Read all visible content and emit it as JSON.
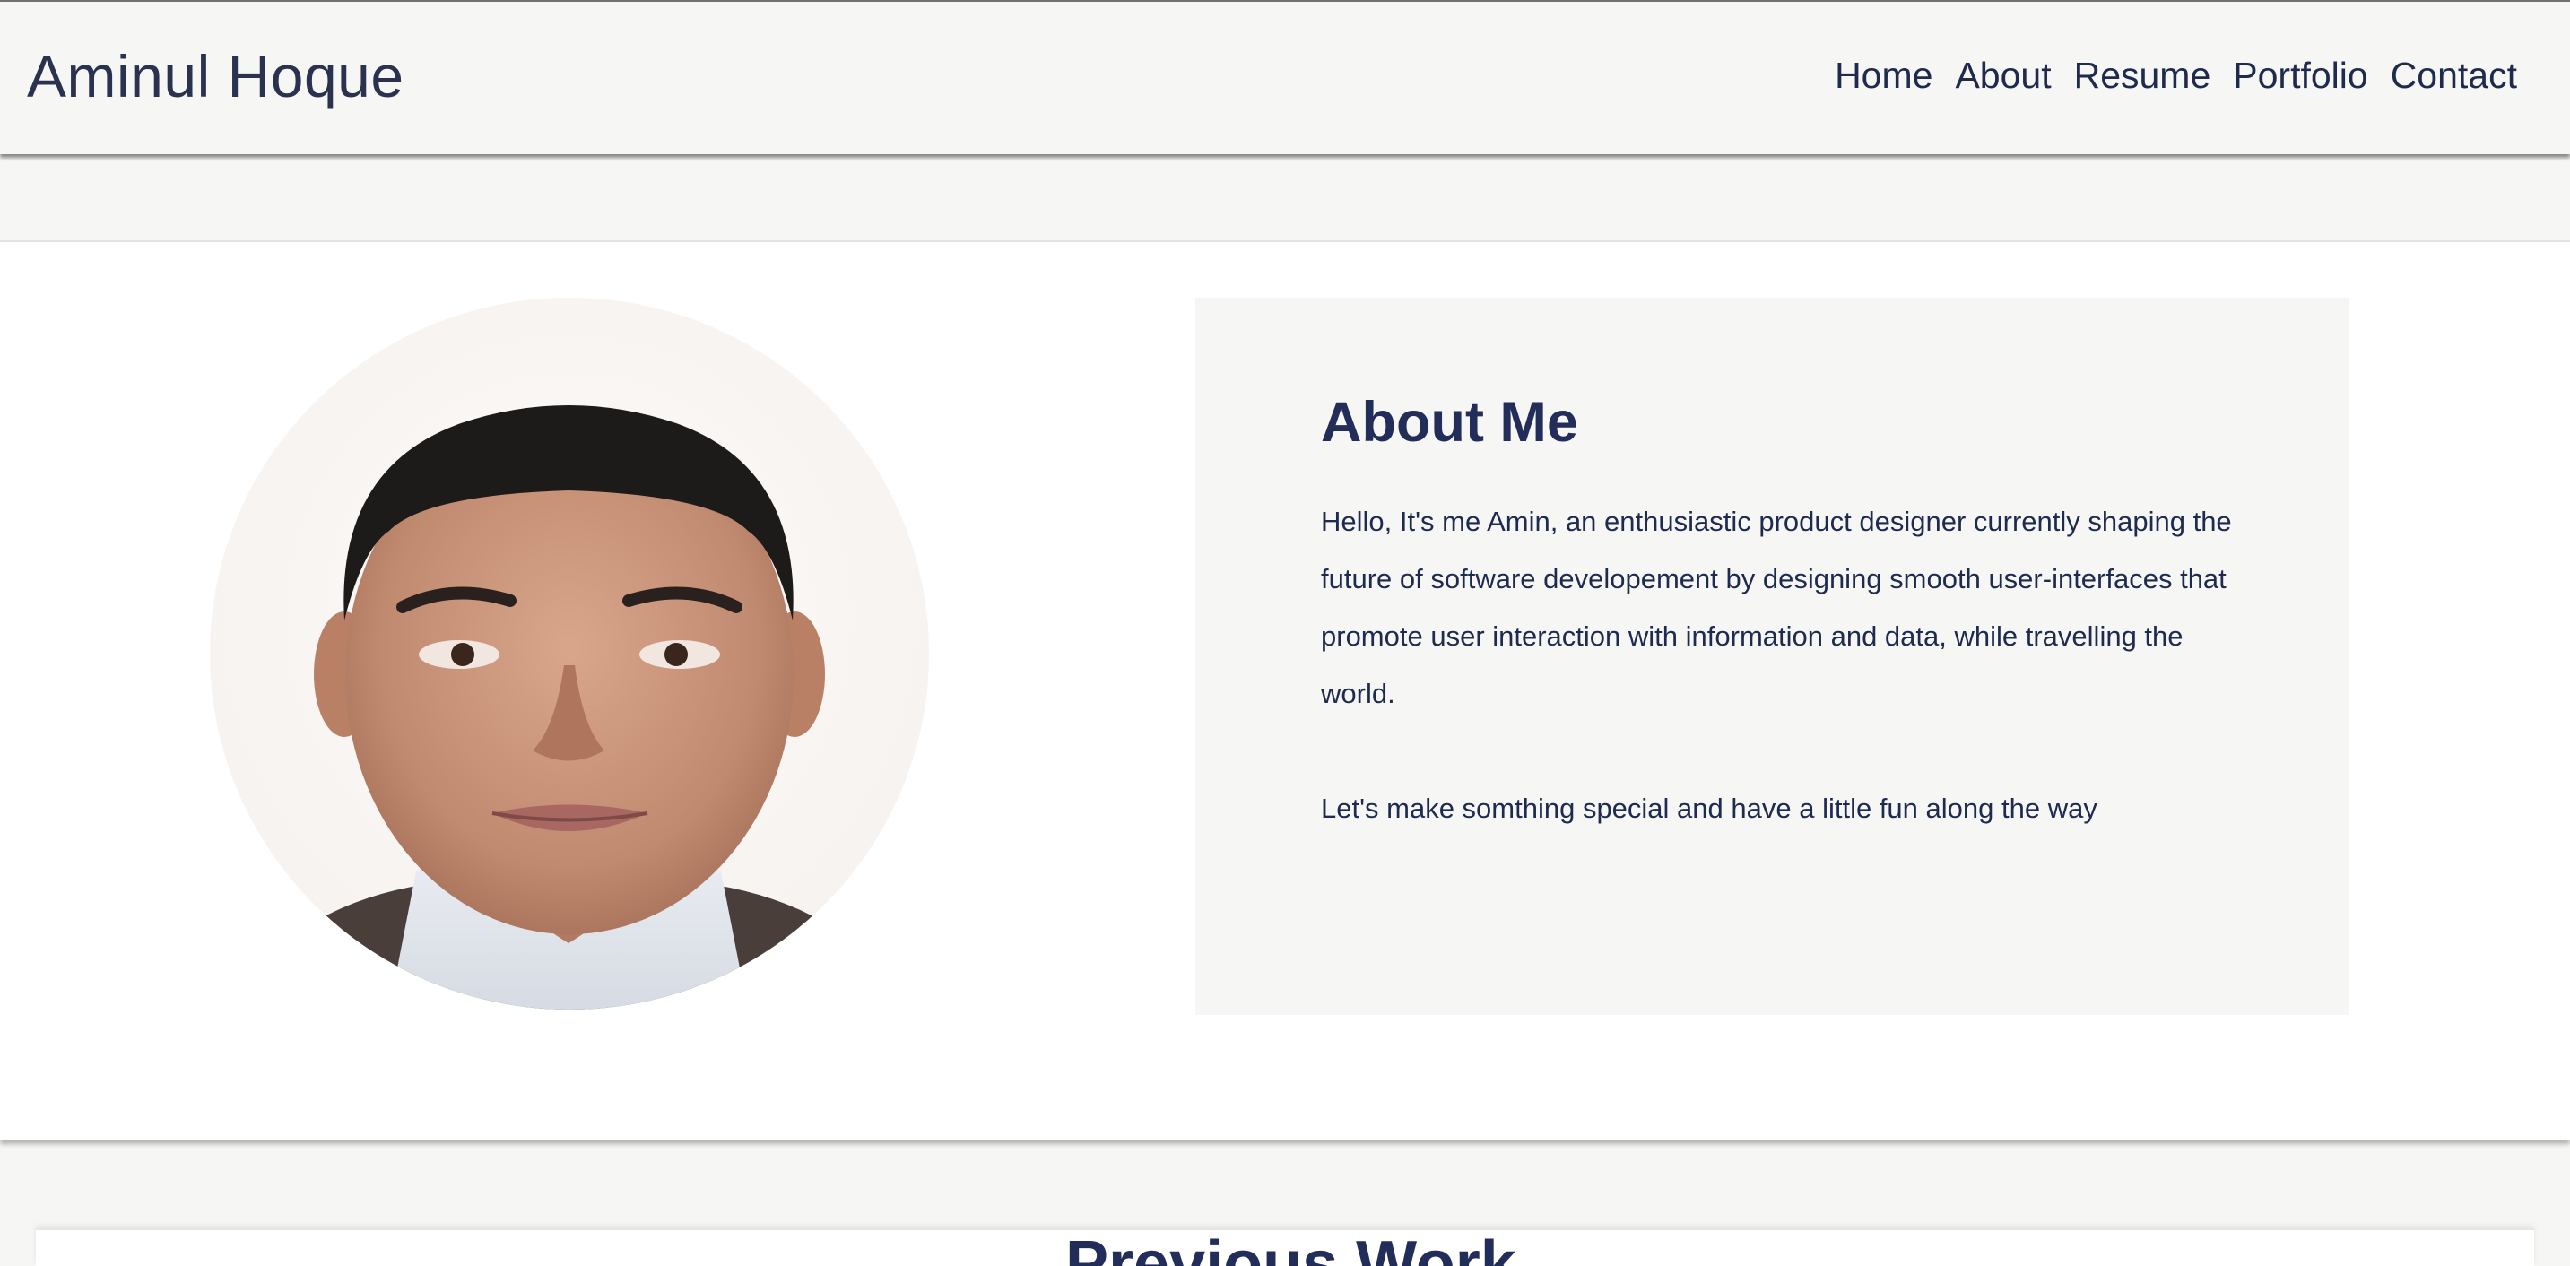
{
  "header": {
    "brand": "Aminul Hoque",
    "nav": [
      "Home",
      "About",
      "Resume",
      "Portfolio",
      "Contact"
    ]
  },
  "about": {
    "title": "About Me",
    "paragraph": "Hello, It's me Amin, an enthusiastic product designer currently shaping the future of software developement by designing smooth user-interfaces that promote user interaction with information and data, while travelling the world.",
    "paragraph2": "Let's make somthing special and have a little fun along the way"
  },
  "next_section": {
    "title": "Previous Work"
  },
  "colors": {
    "accent": "#222d59",
    "header_bg": "#f6f7f5",
    "card_bg": "#f6f7f5",
    "page_bg": "#ffffff"
  }
}
